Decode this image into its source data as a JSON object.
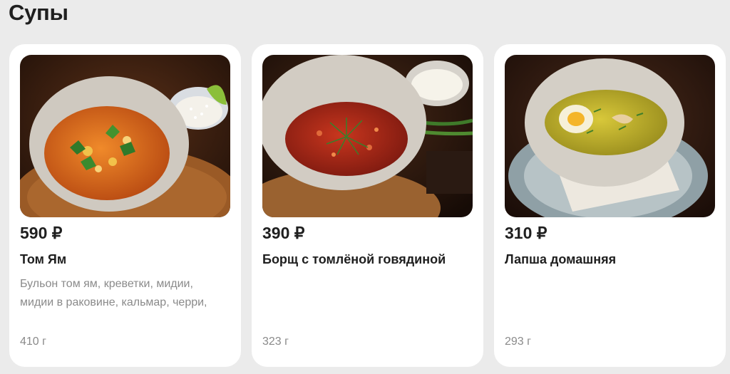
{
  "section": {
    "title": "Супы"
  },
  "products": [
    {
      "price": "590 ₽",
      "name": "Том Ям",
      "description": "Бульон том ям, креветки, мидии, мидии в раковине, кальмар, черри,",
      "weight": "410 г",
      "image_icon": "tom-yum-soup-photo"
    },
    {
      "price": "390 ₽",
      "name": "Борщ с томлёной говядиной",
      "description": "",
      "weight": "323 г",
      "image_icon": "borscht-soup-photo"
    },
    {
      "price": "310 ₽",
      "name": "Лапша домашняя",
      "description": "",
      "weight": "293 г",
      "image_icon": "noodle-soup-photo"
    }
  ]
}
